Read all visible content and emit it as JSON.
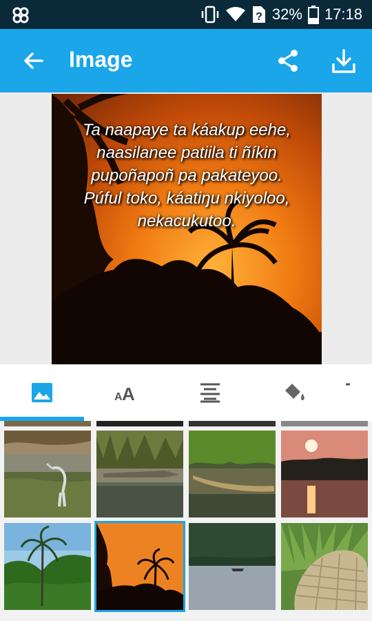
{
  "status_bar": {
    "battery": "32%",
    "time": "17:18",
    "icons": [
      "pinwheel-icon",
      "vibrate-icon",
      "wifi-icon",
      "no-sim-icon",
      "battery-icon"
    ]
  },
  "app_bar": {
    "title": "Image",
    "color": "#1aa6e8",
    "icons": [
      "back-arrow-icon",
      "share-icon",
      "download-icon"
    ]
  },
  "preview": {
    "caption": "Ta naapaye ta káakup eehe, naasilanee patiila ti ñíkin pupoñapoñ pa pakateyoo. Púful toko, káatiŋu nkiyoloo, nekacukutoo."
  },
  "tabs": {
    "items": [
      {
        "icon": "image-icon",
        "selected": true
      },
      {
        "icon": "text-size-icon",
        "selected": false
      },
      {
        "icon": "align-center-icon",
        "selected": false
      },
      {
        "icon": "paint-bucket-icon",
        "selected": false
      },
      {
        "icon": "more-tab-icon",
        "selected": false
      }
    ]
  },
  "backgrounds": {
    "items": [
      {
        "name": "heron-in-water",
        "selected": false
      },
      {
        "name": "crocodile-riverbank",
        "selected": false
      },
      {
        "name": "canoe-on-river",
        "selected": false
      },
      {
        "name": "sunset-over-river",
        "selected": false
      },
      {
        "name": "palm-trees-sky",
        "selected": false
      },
      {
        "name": "orange-palm-sunset",
        "selected": true
      },
      {
        "name": "river-boat-mangroves",
        "selected": false
      },
      {
        "name": "woven-basket-grass",
        "selected": false
      }
    ]
  }
}
